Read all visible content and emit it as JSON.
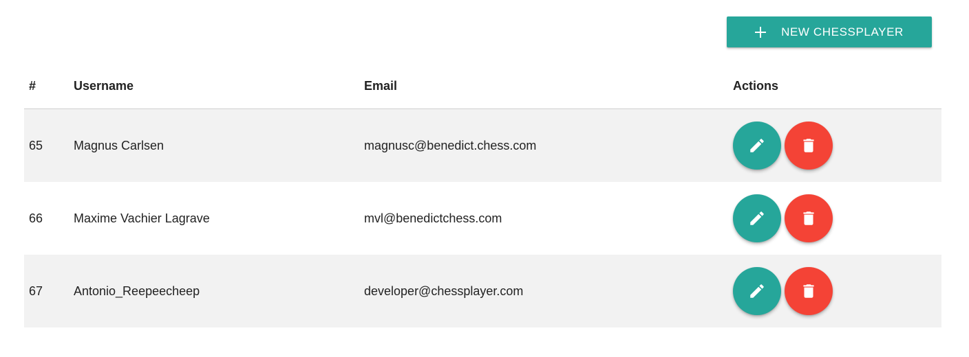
{
  "toolbar": {
    "new_button_label": "NEW CHESSPLAYER",
    "new_button_icon": "plus-icon"
  },
  "table": {
    "headers": {
      "num": "#",
      "username": "Username",
      "email": "Email",
      "actions": "Actions"
    },
    "rows": [
      {
        "id": "65",
        "username": "Magnus Carlsen",
        "email": "magnusc@benedict.chess.com"
      },
      {
        "id": "66",
        "username": "Maxime Vachier Lagrave",
        "email": "mvl@benedictchess.com"
      },
      {
        "id": "67",
        "username": "Antonio_Reepeecheep",
        "email": "developer@chessplayer.com"
      }
    ],
    "row_actions": [
      "edit-icon",
      "trash-icon"
    ]
  },
  "colors": {
    "primary": "#26a69a",
    "danger": "#f44336",
    "row_shade": "#f2f2f2"
  }
}
